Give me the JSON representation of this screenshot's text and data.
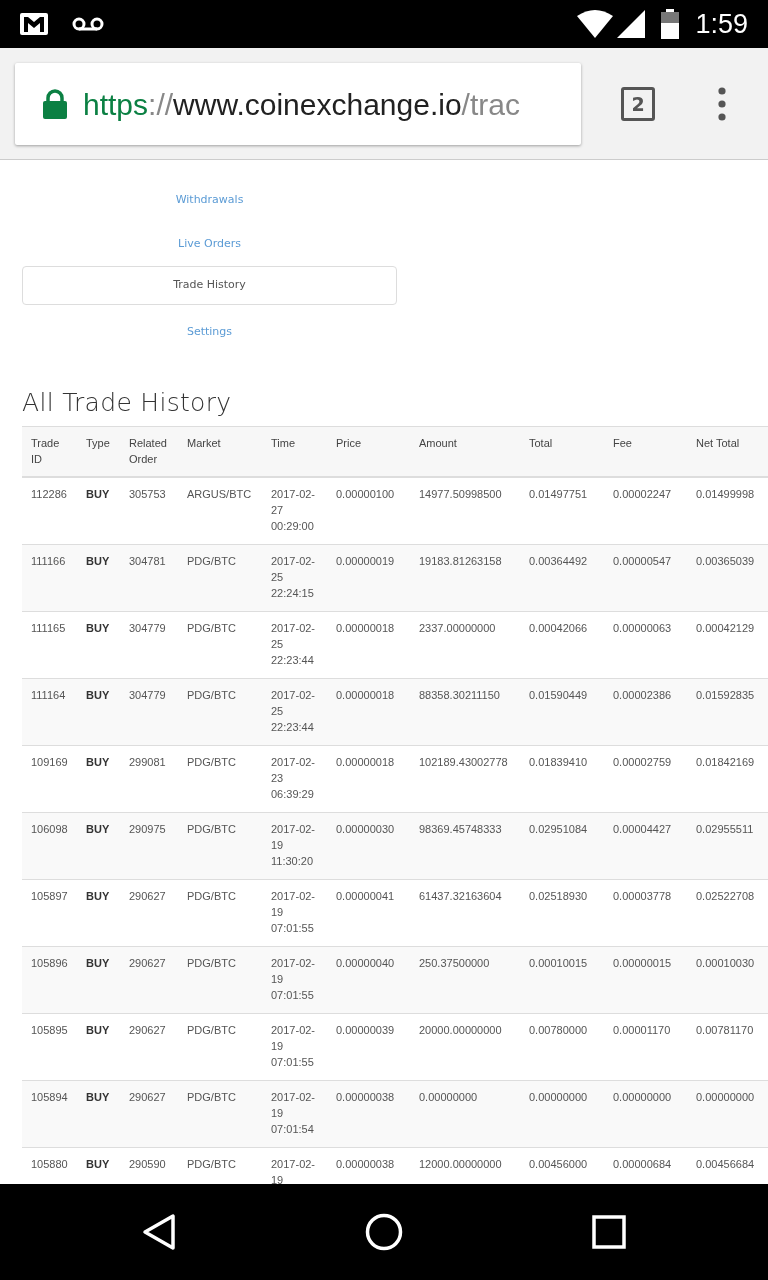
{
  "status_bar": {
    "time": "1:59"
  },
  "address_bar": {
    "url": {
      "scheme": "https",
      "separator": "://",
      "host": "www.coinexchange.io",
      "path": "/trac"
    },
    "tab_count": "2"
  },
  "menu": [
    {
      "label": "Withdrawals",
      "selected": false
    },
    {
      "label": "Live Orders",
      "selected": false
    },
    {
      "label": "Trade History",
      "selected": true
    },
    {
      "label": "Settings",
      "selected": false
    }
  ],
  "heading": "All Trade History",
  "table": {
    "columns": [
      {
        "label": "Trade ID",
        "kind": "plain"
      },
      {
        "label": "Type",
        "kind": "bold"
      },
      {
        "label": "Related Order",
        "kind": "plain"
      },
      {
        "label": "Market",
        "kind": "plain"
      },
      {
        "label": "Time",
        "kind": "plain"
      },
      {
        "label": "Price",
        "kind": "plain"
      },
      {
        "label": "Amount",
        "kind": "plain"
      },
      {
        "label": "Total",
        "kind": "plain"
      },
      {
        "label": "Fee",
        "kind": "plain"
      },
      {
        "label": "Net Total",
        "kind": "plain"
      }
    ],
    "rows": [
      {
        "cells": [
          "112286",
          "BUY",
          "305753",
          "ARGUS/BTC",
          "2017-02-27 00:29:00",
          "0.00000100",
          "14977.50998500",
          "0.01497751",
          "0.00002247",
          "0.01499998"
        ]
      },
      {
        "cells": [
          "111166",
          "BUY",
          "304781",
          "PDG/BTC",
          "2017-02-25 22:24:15",
          "0.00000019",
          "19183.81263158",
          "0.00364492",
          "0.00000547",
          "0.00365039"
        ]
      },
      {
        "cells": [
          "111165",
          "BUY",
          "304779",
          "PDG/BTC",
          "2017-02-25 22:23:44",
          "0.00000018",
          "2337.00000000",
          "0.00042066",
          "0.00000063",
          "0.00042129"
        ]
      },
      {
        "cells": [
          "111164",
          "BUY",
          "304779",
          "PDG/BTC",
          "2017-02-25 22:23:44",
          "0.00000018",
          "88358.30211150",
          "0.01590449",
          "0.00002386",
          "0.01592835"
        ]
      },
      {
        "cells": [
          "109169",
          "BUY",
          "299081",
          "PDG/BTC",
          "2017-02-23 06:39:29",
          "0.00000018",
          "102189.43002778",
          "0.01839410",
          "0.00002759",
          "0.01842169"
        ]
      },
      {
        "cells": [
          "106098",
          "BUY",
          "290975",
          "PDG/BTC",
          "2017-02-19 11:30:20",
          "0.00000030",
          "98369.45748333",
          "0.02951084",
          "0.00004427",
          "0.02955511"
        ]
      },
      {
        "cells": [
          "105897",
          "BUY",
          "290627",
          "PDG/BTC",
          "2017-02-19 07:01:55",
          "0.00000041",
          "61437.32163604",
          "0.02518930",
          "0.00003778",
          "0.02522708"
        ]
      },
      {
        "cells": [
          "105896",
          "BUY",
          "290627",
          "PDG/BTC",
          "2017-02-19 07:01:55",
          "0.00000040",
          "250.37500000",
          "0.00010015",
          "0.00000015",
          "0.00010030"
        ]
      },
      {
        "cells": [
          "105895",
          "BUY",
          "290627",
          "PDG/BTC",
          "2017-02-19 07:01:55",
          "0.00000039",
          "20000.00000000",
          "0.00780000",
          "0.00001170",
          "0.00781170"
        ]
      },
      {
        "cells": [
          "105894",
          "BUY",
          "290627",
          "PDG/BTC",
          "2017-02-19 07:01:54",
          "0.00000038",
          "0.00000000",
          "0.00000000",
          "0.00000000",
          "0.00000000"
        ]
      },
      {
        "cells": [
          "105880",
          "BUY",
          "290590",
          "PDG/BTC",
          "2017-02-19",
          "0.00000038",
          "12000.00000000",
          "0.00456000",
          "0.00000684",
          "0.00456684"
        ]
      }
    ]
  }
}
